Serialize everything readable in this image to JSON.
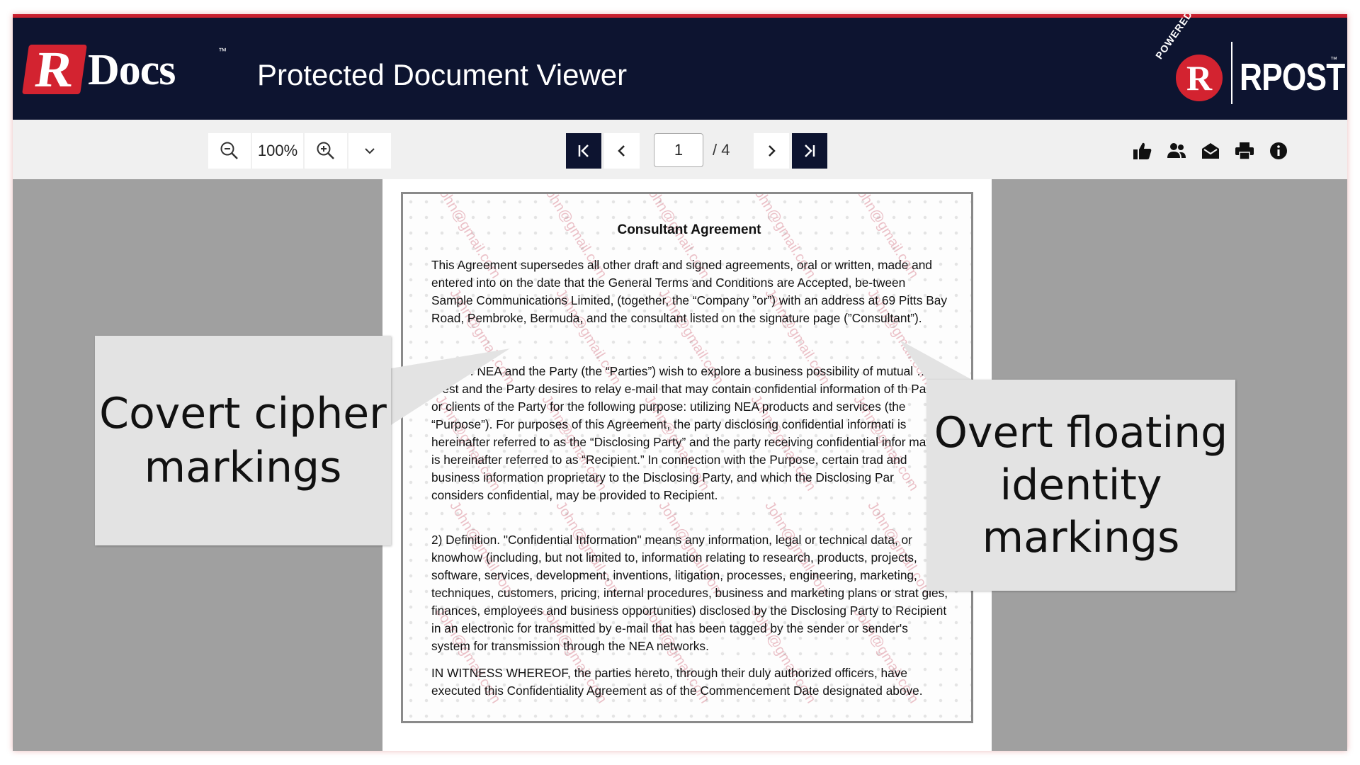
{
  "header": {
    "logo_r": "R",
    "logo_docs": "Docs",
    "logo_tm": "™",
    "title": "Protected Document Viewer",
    "powered_by": "POWERED BY",
    "powered_r": "R",
    "powered_brand": "RPOST",
    "powered_tm": "™"
  },
  "toolbar": {
    "zoom": "100%",
    "page_current": "1",
    "page_total": "/ 4"
  },
  "document": {
    "title": "Consultant Agreement",
    "paragraphs": [
      "This Agreement supersedes all other draft and signed agreements, oral or written, made and entered into on the date that the General Terms and Conditions are Accepted, be-tween Sample Communications Limited, (together, the “Company ”or”) with an address at 69 Pitts Bay Road, Pembroke, Bermuda, and the consultant listed on the signature page (”Consultant”).",
      "…pose. NEA and the Party (the “Parties”) wish to explore a business possibility of mutual …erest and the Party desires to relay e-mail that may contain confidential information of th Party or clients of the Party for the following purpose: utilizing NEA products and services (the “Purpose”). For purposes of this Agreement, the party disclosing confidential informati is hereinafter referred to as the “Disclosing Party” and the party receiving confidential infor mation is hereinafter referred to as “Recipient.” In connection with the Purpose, certain trad and business information proprietary to the Disclosing Party, and which the Disclosing Par considers confidential, may be provided to Recipient.",
      "2) Definition.  \"Confidential Information\" means any information, legal or technical data, or knowhow (including, but not limited to, information relating to research, products, projects, software, services, development, inventions, litigation, processes, engineering, marketing, techniques, customers, pricing, internal procedures, business and marketing plans or strat gies, finances, employees and business opportunities) disclosed by the Disclosing Party to Recipient in an electronic for transmitted by e-mail that has been tagged by the sender or sender's system for transmission through the NEA networks.",
      "IN WITNESS WHEREOF, the parties hereto, through their duly authorized officers, have executed this Confidentiality Agreement as of the Commencement Date designated above."
    ],
    "watermark": "John@gmail.com"
  },
  "callouts": {
    "left": "Covert cipher markings",
    "right": "Overt floating identity markings"
  },
  "icons": {
    "zoom_out": "zoom-out-icon",
    "zoom_in": "zoom-in-icon",
    "zoom_menu": "chevron-down-icon",
    "first_page": "first-page-icon",
    "prev_page": "chevron-left-icon",
    "next_page": "chevron-right-icon",
    "last_page": "last-page-icon",
    "like": "thumbs-up-icon",
    "share": "people-icon",
    "email": "envelope-icon",
    "print": "printer-icon",
    "info": "info-icon"
  },
  "colors": {
    "header_bg": "#0d1430",
    "brand_red": "#d32330",
    "toolbar_bg": "#f0f0f0",
    "viewer_bg": "#a0a0a0"
  }
}
